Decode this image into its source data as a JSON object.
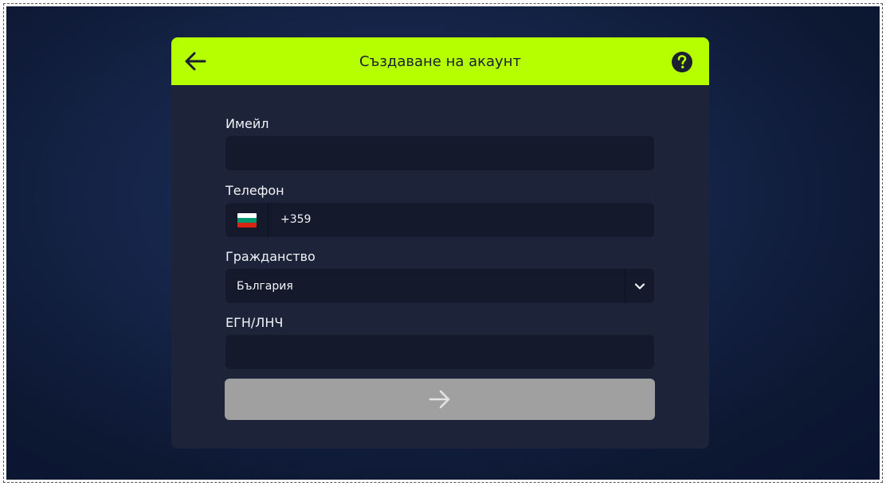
{
  "header": {
    "title": "Създаване на акаунт",
    "back_icon": "arrow-left-icon",
    "help_icon": "question-circle-icon",
    "accent_color": "#b6ff00"
  },
  "form": {
    "email": {
      "label": "Имейл",
      "value": ""
    },
    "phone": {
      "label": "Телефон",
      "country_flag": "bulgaria-flag-icon",
      "prefix": "+359",
      "value": ""
    },
    "citizenship": {
      "label": "Гражданство",
      "selected": "България",
      "dropdown_icon": "chevron-down-icon"
    },
    "egn": {
      "label": "ЕГН/ЛНЧ",
      "value": ""
    },
    "submit": {
      "icon": "arrow-right-icon",
      "state": "disabled",
      "color": "#a0a0a0"
    }
  },
  "colors": {
    "card_background": "#1d2338",
    "field_background": "#141a2c",
    "page_background": "#142346"
  }
}
